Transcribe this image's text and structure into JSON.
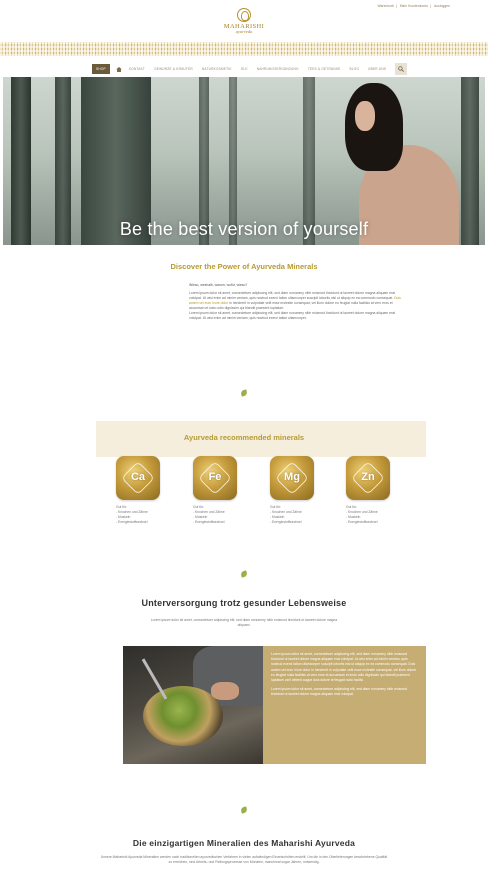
{
  "topbar": {
    "items": [
      "Warenkorb",
      "Mein Kundenkonto",
      "Ausloggen"
    ]
  },
  "logo": {
    "brand": "MAHARISHI",
    "sub": "ayurveda"
  },
  "nav": {
    "items": [
      "SHOP",
      "KONTAKT",
      "GEWÜRZE & KRÄUTER",
      "NATURKOSMETIK",
      "ÖLE",
      "NAHRUNGSERGÄNZUNG",
      "TEES & GETRÄNKE",
      "BLOG",
      "ÜBER UNS"
    ],
    "active_index": 0
  },
  "hero": {
    "title": "Be the best version of yourself"
  },
  "discover": {
    "title": "Discover the Power of Ayurveda Minerals",
    "question": "Wieso, weshalb, warum, wofür, wieso?",
    "p1": "Lorem ipsum dolor sit amet, consectetuer adipiscing elit, sed diam nonummy nibh euismod tincidunt ut laoreet dolore magna aliquam erat volutpat. Ut wisi enim ad minim veniam, quis nostrud exerci tation ullamcorper suscipit lobortis nisl ut aliquip ex ea commodo consequat.",
    "link": "Duis autem vel eum iriure dolor",
    "p2": "in hendrerit in vulputate velit esse molestie consequat, vel illum dolore eu feugiat nulla facilisis at vero eros et accumsan et iusto odio dignissim qui blandit praesent luptatum.",
    "p3": "Lorem ipsum dolor sit amet, consectetuer adipiscing elit, sed diam nonummy nibh euismod tincidunt ut laoreet dolore magna aliquam erat volutpat. Ut wisi enim ad minim veniam, quis nostrud exerci tation ullamcorper."
  },
  "minerals": {
    "title": "Ayurveda recommended minerals",
    "items": [
      {
        "symbol": "Ca",
        "heading": "Gut für:",
        "lines": [
          "- Knochen und Zähne",
          "- Muskeln",
          "- Energiestoffwechsel"
        ]
      },
      {
        "symbol": "Fe",
        "heading": "Gut für:",
        "lines": [
          "- Knochen und Zähne",
          "- Muskeln",
          "- Energiestoffwechsel"
        ]
      },
      {
        "symbol": "Mg",
        "heading": "Gut für:",
        "lines": [
          "- Knochen und Zähne",
          "- Muskeln",
          "- Energiestoffwechsel"
        ]
      },
      {
        "symbol": "Zn",
        "heading": "Gut für:",
        "lines": [
          "- Knochen und Zähne",
          "- Muskeln",
          "- Energiestoffwechsel"
        ]
      }
    ]
  },
  "undersupply": {
    "title": "Unterversorgung trotz gesunder Lebensweise",
    "text": "Lorem ipsum dolor sit amet, consectetuer adipiscing elit, sed diam nonummy nibh euismod tincidunt ut laoreet dolore magna aliquam.",
    "box_p1": "Lorem ipsum dolor sit amet, consectetuer adipiscing elit, sed diam nonummy nibh euismod tincidunt ut laoreet dolore magna aliquam erat volutpat. Ut wisi enim ad minim veniam, quis nostrud exerci tation ullamcorper suscipit lobortis nisl ut aliquip ex ea commodo consequat. Duis autem vel eum iriure dolor in hendrerit in vulputate velit esse molestie consequat, vel illum dolore eu feugiat nulla facilisis at vero eros et accumsan et iusto odio dignissim qui blandit praesent luptatum zzril delenit augue duis dolore te feugait nulla facilisi.",
    "box_p2": "Lorem ipsum dolor sit amet, consectetuer adipiscing elit, sed diam nonummy nibh euismod tincidunt ut laoreet dolore magna aliquam erat volutpat."
  },
  "unique": {
    "title": "Die einzigartigen Mineralien des Maharishi Ayurveda",
    "text": "Unsere Maharishi Ayurveda Mineralien werden nach traditionellen ayurvedischen Verfahren in vielen aufwändigen Einzelschritten erstellt. Um die in den Überlieferungen beschriebene Qualität zu erreichen, sind Arbeits- und Reifungsprozesse von Monaten, manchmal sogar Jahren, notwendig."
  },
  "colors": {
    "gold": "#b79a32",
    "nav_active": "#6b5b3a",
    "box": "#c6ad73",
    "band": "#f5eedd"
  }
}
